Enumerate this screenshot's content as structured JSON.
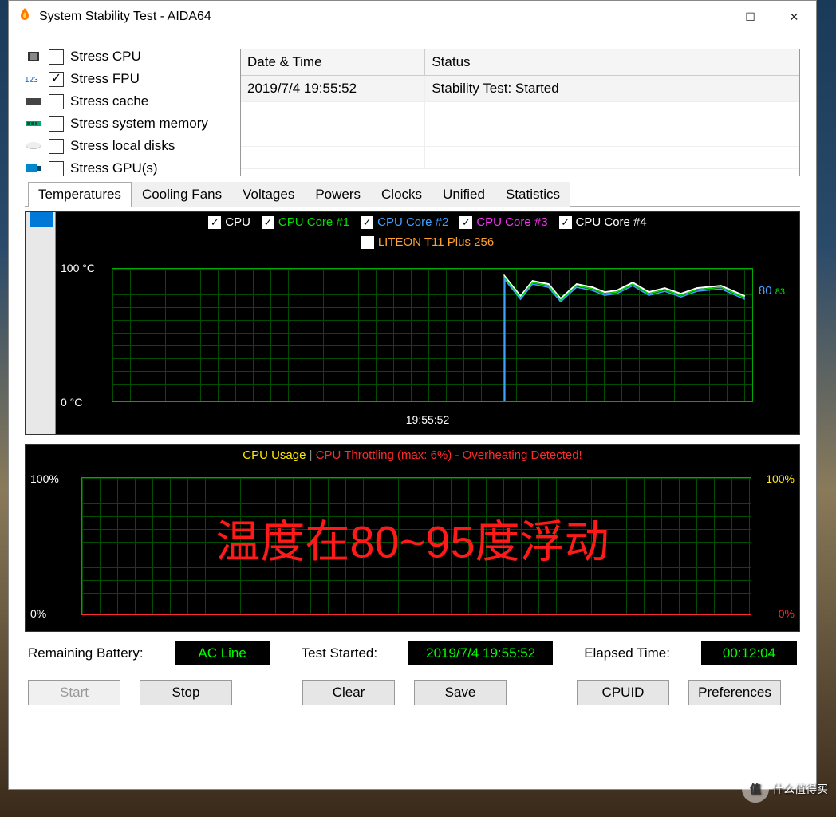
{
  "window": {
    "title": "System Stability Test - AIDA64"
  },
  "stress_options": [
    {
      "label": "Stress CPU",
      "checked": false
    },
    {
      "label": "Stress FPU",
      "checked": true
    },
    {
      "label": "Stress cache",
      "checked": false
    },
    {
      "label": "Stress system memory",
      "checked": false
    },
    {
      "label": "Stress local disks",
      "checked": false
    },
    {
      "label": "Stress GPU(s)",
      "checked": false
    }
  ],
  "log": {
    "headers": {
      "date": "Date & Time",
      "status": "Status"
    },
    "rows": [
      {
        "date": "2019/7/4 19:55:52",
        "status": "Stability Test: Started"
      }
    ]
  },
  "tabs": [
    "Temperatures",
    "Cooling Fans",
    "Voltages",
    "Powers",
    "Clocks",
    "Unified",
    "Statistics"
  ],
  "active_tab": 0,
  "temp_graph": {
    "legend": [
      {
        "label": "CPU",
        "color": "#ffffff",
        "checked": true
      },
      {
        "label": "CPU Core #1",
        "color": "#00e000",
        "checked": true
      },
      {
        "label": "CPU Core #2",
        "color": "#40a0ff",
        "checked": true
      },
      {
        "label": "CPU Core #3",
        "color": "#ff30ff",
        "checked": true
      },
      {
        "label": "CPU Core #4",
        "color": "#ffffff",
        "checked": true
      }
    ],
    "legend2": [
      {
        "label": "LITEON T11 Plus 256",
        "color": "#ffa030",
        "checked": false
      }
    ],
    "y_max": "100 °C",
    "y_min": "0 °C",
    "time_label": "19:55:52",
    "current_value": "80",
    "current_suffix": "83"
  },
  "usage_graph": {
    "title_left": "CPU Usage",
    "title_right": "CPU Throttling (max: 6%) - Overheating Detected!",
    "y_max": "100%",
    "y_min": "0%",
    "right_max": "100%",
    "right_min": "0%"
  },
  "overlay_text": "温度在80~95度浮动",
  "status": {
    "battery_label": "Remaining Battery:",
    "battery_value": "AC Line",
    "started_label": "Test Started:",
    "started_value": "2019/7/4 19:55:52",
    "elapsed_label": "Elapsed Time:",
    "elapsed_value": "00:12:04"
  },
  "buttons": {
    "start": "Start",
    "stop": "Stop",
    "clear": "Clear",
    "save": "Save",
    "cpuid": "CPUID",
    "prefs": "Preferences"
  },
  "watermark": "什么值得买",
  "watermark_badge": "值",
  "chart_data": [
    {
      "type": "line",
      "title": "Temperatures",
      "ylabel": "°C",
      "ylim": [
        0,
        100
      ],
      "x_marker": "19:55:52",
      "series": [
        {
          "name": "CPU",
          "color": "#ffffff",
          "approx_values": [
            95,
            82,
            92,
            90,
            80,
            90,
            88,
            85,
            86,
            90,
            85,
            88,
            82,
            88,
            80
          ]
        },
        {
          "name": "CPU Core #1",
          "color": "#00e000",
          "approx_values": [
            95,
            83,
            92,
            90,
            81,
            90,
            88,
            86,
            86,
            90,
            85,
            88,
            83,
            88,
            80
          ]
        },
        {
          "name": "CPU Core #2",
          "color": "#40a0ff",
          "approx_values": [
            95,
            80,
            91,
            89,
            79,
            89,
            87,
            84,
            85,
            89,
            84,
            87,
            81,
            87,
            79
          ]
        },
        {
          "name": "CPU Core #3",
          "color": "#ff30ff",
          "approx_values": [
            95,
            82,
            92,
            90,
            80,
            90,
            88,
            85,
            86,
            90,
            85,
            88,
            82,
            88,
            80
          ]
        },
        {
          "name": "CPU Core #4",
          "color": "#ffffff",
          "approx_values": [
            95,
            82,
            92,
            90,
            80,
            90,
            88,
            85,
            86,
            90,
            85,
            88,
            82,
            88,
            80
          ]
        }
      ],
      "note": "data begins near 19:55:52 vertical marker; prior region has no data; current ≈80-83°C"
    },
    {
      "type": "line",
      "title": "CPU Usage / CPU Throttling",
      "ylim": [
        0,
        100
      ],
      "series": [
        {
          "name": "CPU Usage",
          "color": "#ffea00",
          "approx_values": [
            0,
            0,
            0,
            0,
            0,
            0,
            0,
            0,
            0,
            0
          ]
        },
        {
          "name": "CPU Throttling",
          "color": "#ff2a2a",
          "max": 6,
          "approx_values": [
            0,
            0,
            0,
            0,
            0,
            0,
            0,
            0,
            0,
            0
          ]
        }
      ],
      "annotation": "Overheating Detected!"
    }
  ]
}
